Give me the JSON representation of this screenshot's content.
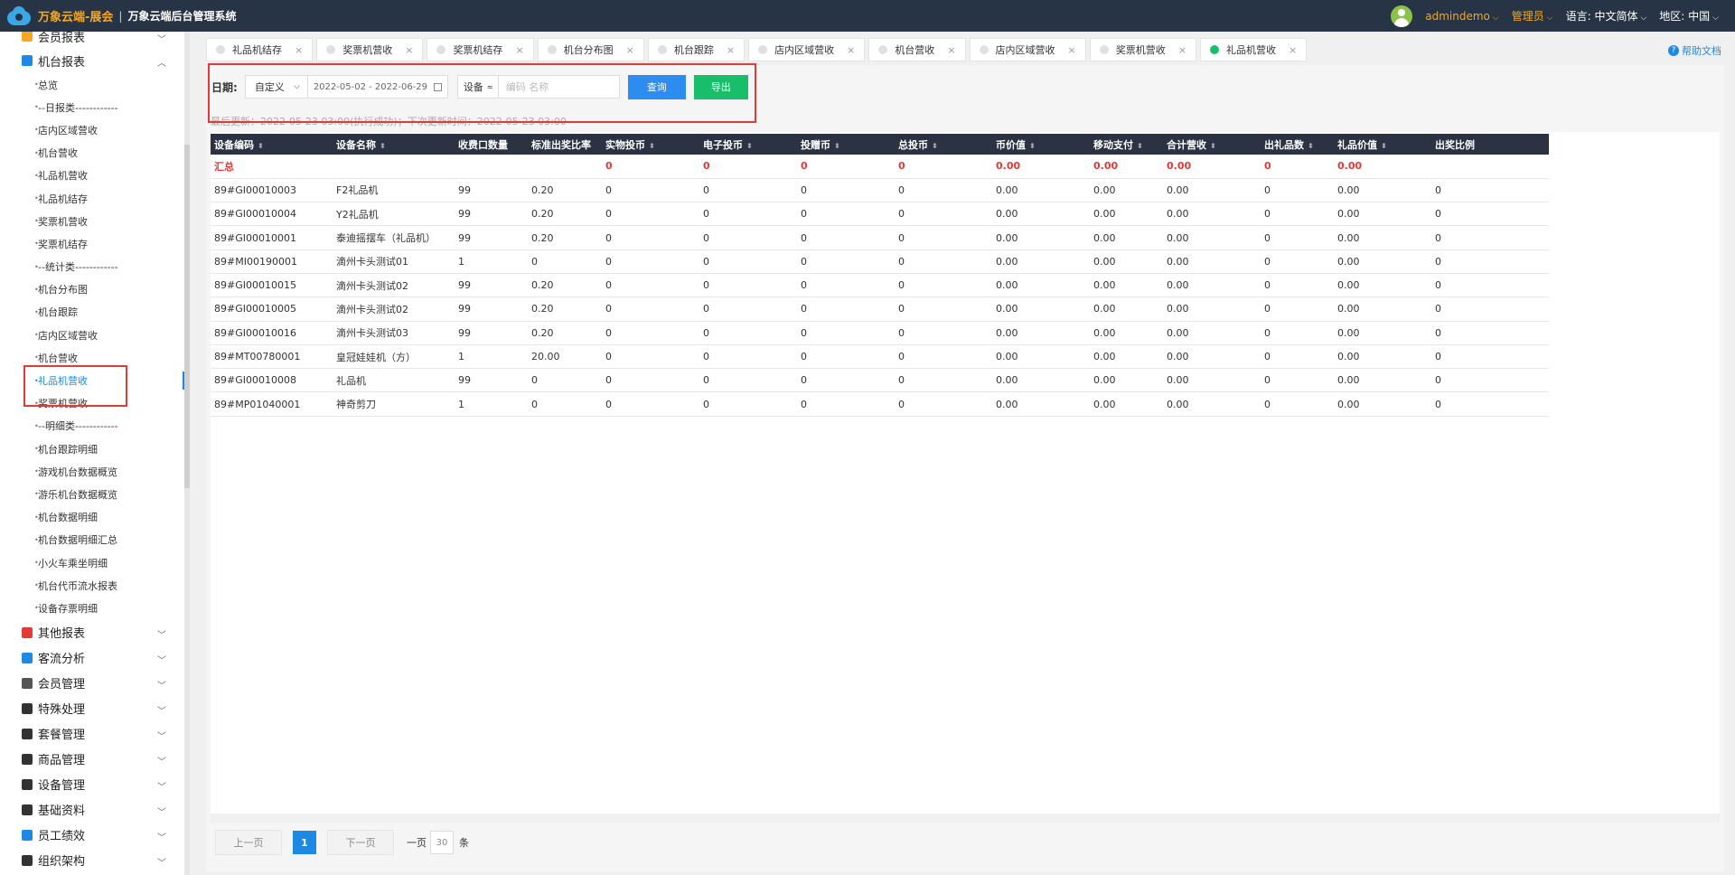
{
  "topbar": {
    "brand": "万象云端-展会",
    "separator": "|",
    "system_title": "万象云端后台管理系统",
    "username": "admindemo",
    "role": "管理员",
    "language_label": "语言:",
    "language_value": "中文简体",
    "region_label": "地区:",
    "region_value": "中国"
  },
  "sidebar": {
    "groups_top": [
      {
        "label": "会员报表",
        "icon": "chart-icon",
        "icon_color": "#f5a623"
      },
      {
        "label": "机台报表",
        "icon": "grid-icon",
        "icon_color": "#1e88e5"
      }
    ],
    "items": [
      "总览",
      "--日报类------------",
      "店内区域营收",
      "机台营收",
      "礼品机营收",
      "礼品机结存",
      "奖票机营收",
      "奖票机结存",
      "--统计类------------",
      "机台分布图",
      "机台跟踪",
      "店内区域营收",
      "机台营收",
      "礼品机营收",
      "奖票机营收",
      "--明细类------------",
      "机台跟踪明细",
      "游戏机台数据概览",
      "游乐机台数据概览",
      "机台数据明细",
      "机台数据明细汇总",
      "小火车乘坐明细",
      "机台代币流水报表",
      "设备存票明细"
    ],
    "groups_bottom": [
      {
        "label": "其他报表",
        "icon": "layers-icon",
        "icon_color": "#e53935"
      },
      {
        "label": "客流分析",
        "icon": "target-icon",
        "icon_color": "#1e88e5"
      },
      {
        "label": "会员管理",
        "icon": "person-icon",
        "icon_color": "#555555"
      },
      {
        "label": "特殊处理",
        "icon": "warning-icon",
        "icon_color": "#333333"
      },
      {
        "label": "套餐管理",
        "icon": "edit-icon",
        "icon_color": "#333333"
      },
      {
        "label": "商品管理",
        "icon": "refresh-icon",
        "icon_color": "#333333"
      },
      {
        "label": "设备管理",
        "icon": "tools-icon",
        "icon_color": "#333333"
      },
      {
        "label": "基础资料",
        "icon": "doc-icon",
        "icon_color": "#333333"
      },
      {
        "label": "员工绩效",
        "icon": "cube-icon",
        "icon_color": "#1e88e5"
      },
      {
        "label": "组织架构",
        "icon": "org-icon",
        "icon_color": "#333333"
      }
    ]
  },
  "tabs": [
    {
      "label": "礼品机结存"
    },
    {
      "label": "奖票机营收"
    },
    {
      "label": "奖票机结存"
    },
    {
      "label": "机台分布图"
    },
    {
      "label": "机台跟踪"
    },
    {
      "label": "店内区域营收"
    },
    {
      "label": "机台营收"
    },
    {
      "label": "店内区域营收"
    },
    {
      "label": "奖票机营收"
    },
    {
      "label": "礼品机营收"
    }
  ],
  "help_label": "帮助文档",
  "filter": {
    "date_label": "日期:",
    "mode_value": "自定义",
    "date_range": "2022-05-02 - 2022-06-29",
    "device_select": "设备",
    "device_placeholder": "编码 名称",
    "query_label": "查询",
    "export_label": "导出",
    "last_update": "最后更新：2022-05-23 03:00(执行成功)；下次更新时间：2022-05-23 03:00"
  },
  "table": {
    "headers": [
      "设备编码",
      "设备名称",
      "收费口数量",
      "标准出奖比率",
      "实物投币",
      "电子投币",
      "投赠币",
      "总投币",
      "币价值",
      "移动支付",
      "合计营收",
      "出礼品数",
      "礼品价值",
      "出奖比例"
    ],
    "total": [
      "汇总",
      "",
      "",
      "",
      "0",
      "0",
      "0",
      "0",
      "0.00",
      "0.00",
      "0.00",
      "0",
      "0.00",
      ""
    ],
    "rows": [
      [
        "89#GI00010003",
        "F2礼品机",
        "99",
        "0.20",
        "0",
        "0",
        "0",
        "0",
        "0.00",
        "0.00",
        "0.00",
        "0",
        "0.00",
        "0"
      ],
      [
        "89#GI00010004",
        "Y2礼品机",
        "99",
        "0.20",
        "0",
        "0",
        "0",
        "0",
        "0.00",
        "0.00",
        "0.00",
        "0",
        "0.00",
        "0"
      ],
      [
        "89#GI00010001",
        "泰迪摇摆车（礼品机）",
        "99",
        "0.20",
        "0",
        "0",
        "0",
        "0",
        "0.00",
        "0.00",
        "0.00",
        "0",
        "0.00",
        "0"
      ],
      [
        "89#MI00190001",
        "滴州卡头测试01",
        "1",
        "0",
        "0",
        "0",
        "0",
        "0",
        "0.00",
        "0.00",
        "0.00",
        "0",
        "0.00",
        "0"
      ],
      [
        "89#GI00010015",
        "滴州卡头测试02",
        "99",
        "0.20",
        "0",
        "0",
        "0",
        "0",
        "0.00",
        "0.00",
        "0.00",
        "0",
        "0.00",
        "0"
      ],
      [
        "89#GI00010005",
        "滴州卡头测试02",
        "99",
        "0.20",
        "0",
        "0",
        "0",
        "0",
        "0.00",
        "0.00",
        "0.00",
        "0",
        "0.00",
        "0"
      ],
      [
        "89#GI00010016",
        "滴州卡头测试03",
        "99",
        "0.20",
        "0",
        "0",
        "0",
        "0",
        "0.00",
        "0.00",
        "0.00",
        "0",
        "0.00",
        "0"
      ],
      [
        "89#MT00780001",
        "皇冠娃娃机（方）",
        "1",
        "20.00",
        "0",
        "0",
        "0",
        "0",
        "0.00",
        "0.00",
        "0.00",
        "0",
        "0.00",
        "0"
      ],
      [
        "89#GI00010008",
        "礼品机",
        "99",
        "0",
        "0",
        "0",
        "0",
        "0",
        "0.00",
        "0.00",
        "0.00",
        "0",
        "0.00",
        "0"
      ],
      [
        "89#MP01040001",
        "神奇剪刀",
        "1",
        "0",
        "0",
        "0",
        "0",
        "0",
        "0.00",
        "0.00",
        "0.00",
        "0",
        "0.00",
        "0"
      ]
    ]
  },
  "pager": {
    "prev_label": "上一页",
    "current_page": "1",
    "next_label": "下一页",
    "per_page_label": "一页",
    "page_size": "30",
    "unit_label": "条"
  }
}
